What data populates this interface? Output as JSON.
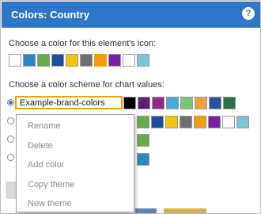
{
  "dialog": {
    "title": "Colors: Country",
    "help_icon": "?"
  },
  "icon_section": {
    "label": "Choose a color for this element's icon:",
    "swatches": [
      "#ffffff",
      "#2e86c1",
      "#6aa84f",
      "#1f4e9c",
      "#f1c40f",
      "#6f6f6f",
      "#f39c12",
      "#7b1fa2",
      "#ffffff",
      "#7ec3d6"
    ],
    "selected_index": 6
  },
  "scheme_section": {
    "label": "Choose a color scheme for chart values:",
    "selected_scheme_value": "Example-brand-colors",
    "scheme1_swatches": [
      "#000000",
      "#5b1f6f",
      "#8e2a8a",
      "#4aa8d8",
      "#7cc576",
      "#e8a33c",
      "#2a4fa0",
      "#2e6e4a"
    ],
    "scheme2_swatches": [
      "#6aa84f",
      "#1f4e9c",
      "#f1c40f",
      "#6f6f6f",
      "#f39c12",
      "#7b1fa2",
      "#ffffff",
      "#7ec3d6"
    ],
    "scheme3_swatches": [
      "#6aa84f"
    ],
    "scheme4_swatches": [
      "#2e86c1"
    ]
  },
  "context_menu": {
    "items": [
      "Rename",
      "Delete",
      "Add color",
      "Copy theme",
      "New theme"
    ]
  },
  "colors": {
    "accent": "#2f76c8",
    "highlight": "#f0a000"
  }
}
